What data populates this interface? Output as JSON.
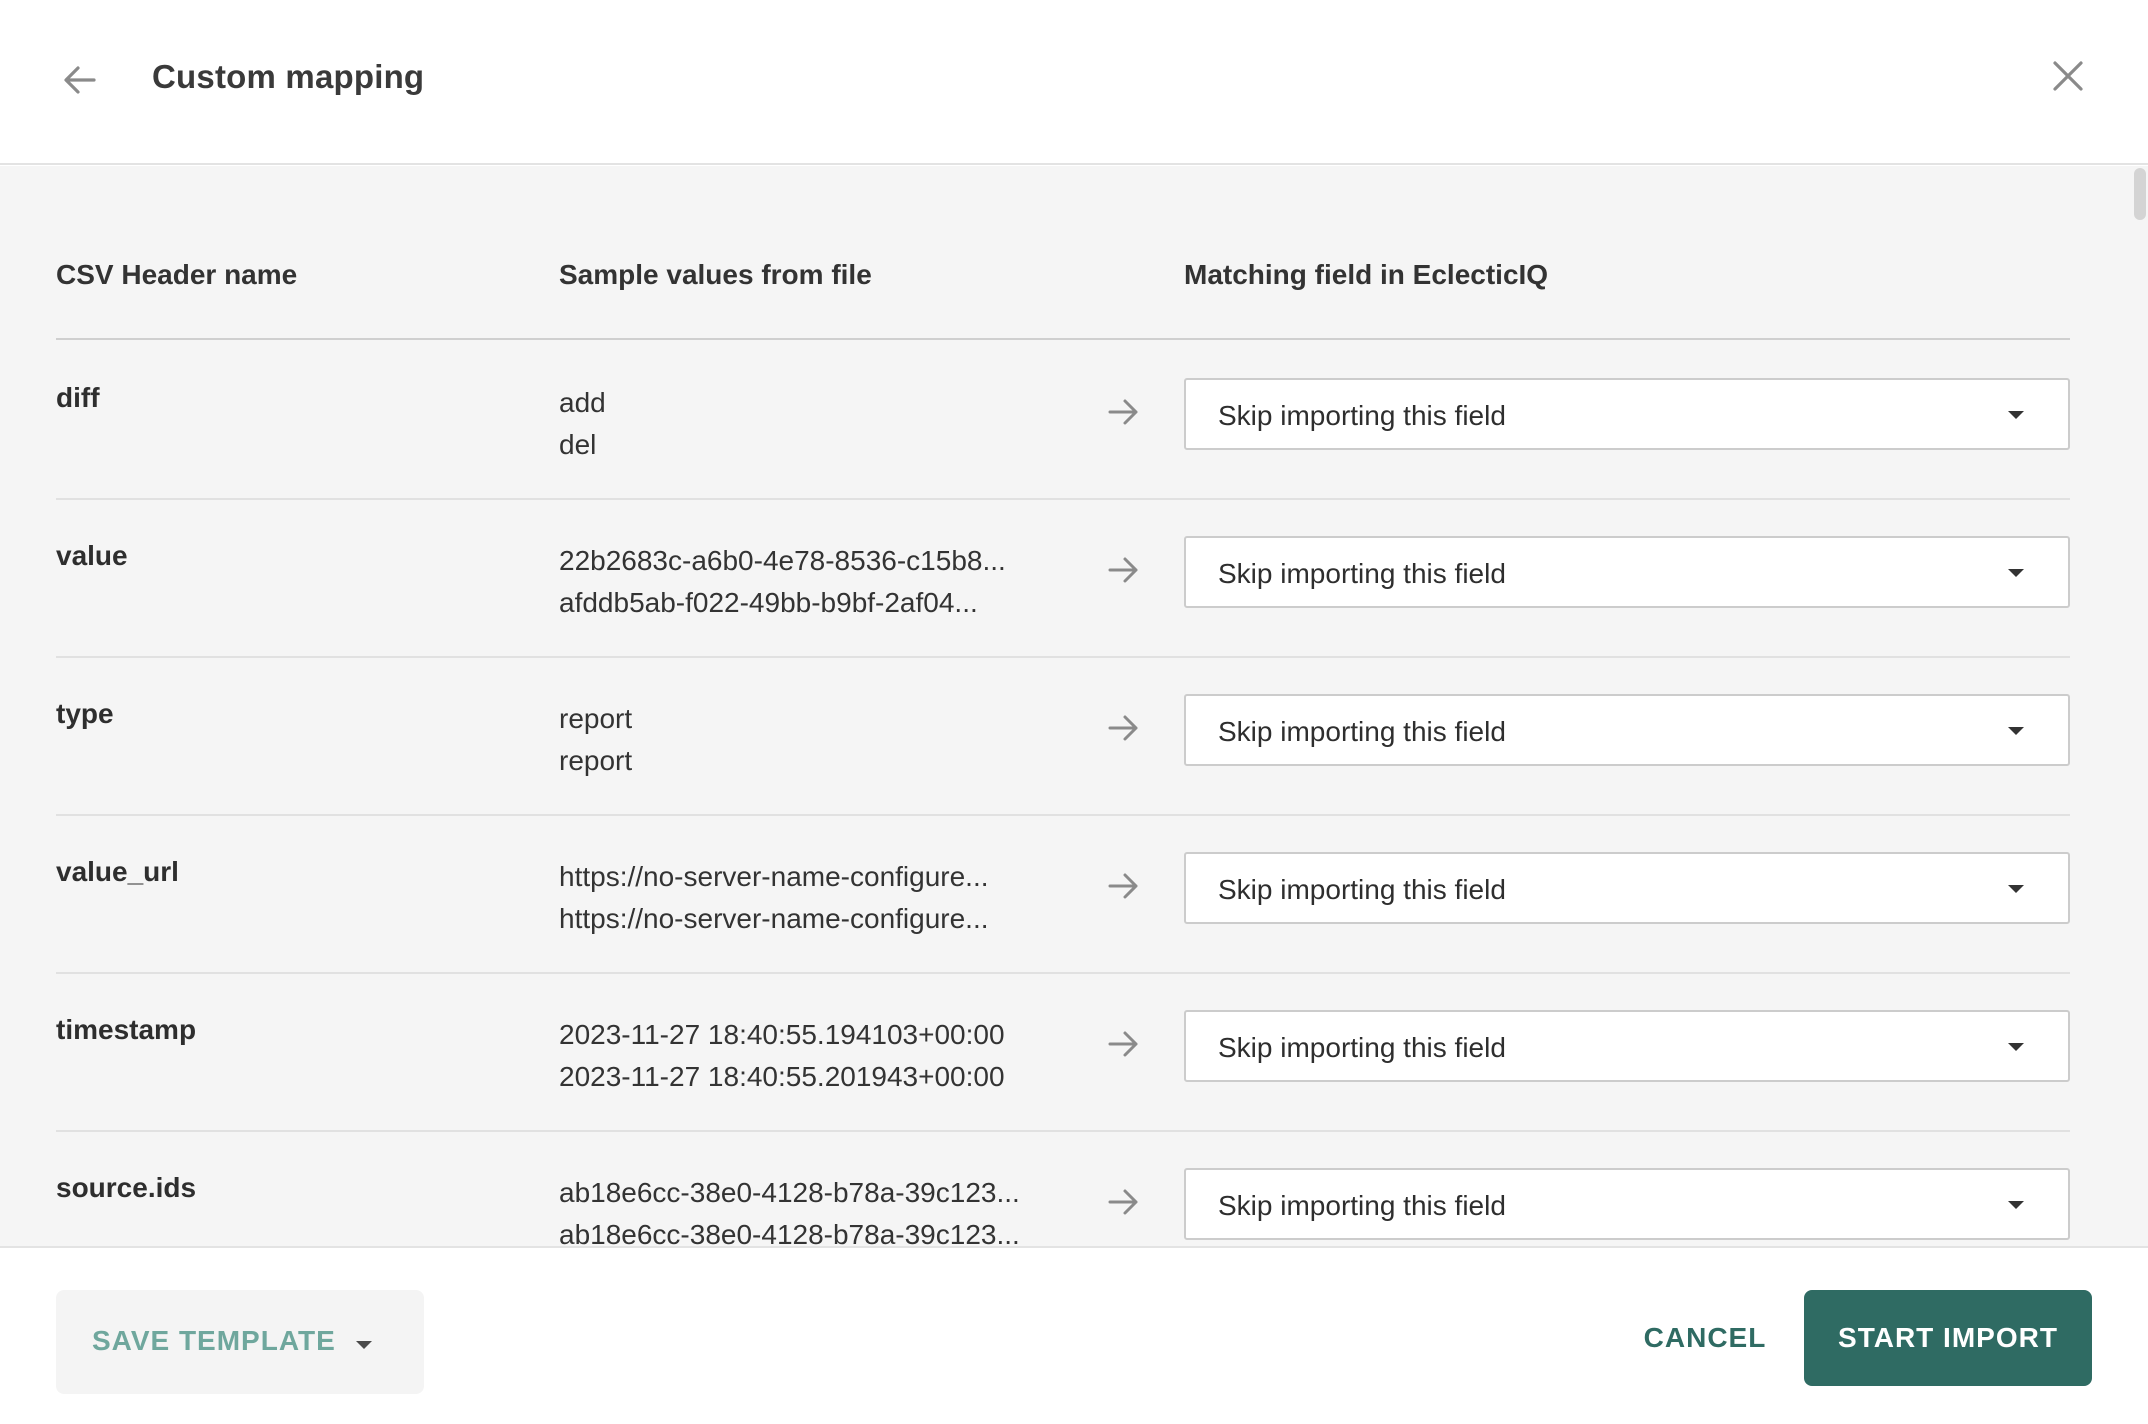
{
  "header": {
    "title": "Custom mapping",
    "back_icon": "arrow-left-icon",
    "close_icon": "close-icon"
  },
  "table": {
    "columns": [
      "CSV Header name",
      "Sample values from file",
      "Matching field in EclecticIQ"
    ],
    "rows": [
      {
        "header": "diff",
        "samples": [
          "add",
          "del"
        ],
        "mapping": "Skip importing this field"
      },
      {
        "header": "value",
        "samples": [
          "22b2683c-a6b0-4e78-8536-c15b8...",
          "afddb5ab-f022-49bb-b9bf-2af04..."
        ],
        "mapping": "Skip importing this field"
      },
      {
        "header": "type",
        "samples": [
          "report",
          "report"
        ],
        "mapping": "Skip importing this field"
      },
      {
        "header": "value_url",
        "samples": [
          "https://no-server-name-configure...",
          "https://no-server-name-configure..."
        ],
        "mapping": "Skip importing this field"
      },
      {
        "header": "timestamp",
        "samples": [
          "2023-11-27 18:40:55.194103+00:00",
          "2023-11-27 18:40:55.201943+00:00"
        ],
        "mapping": "Skip importing this field"
      },
      {
        "header": "source.ids",
        "samples": [
          "ab18e6cc-38e0-4128-b78a-39c123...",
          "ab18e6cc-38e0-4128-b78a-39c123..."
        ],
        "mapping": "Skip importing this field"
      }
    ]
  },
  "footer": {
    "save_template_label": "SAVE TEMPLATE",
    "cancel_label": "CANCEL",
    "start_import_label": "START IMPORT"
  },
  "colors": {
    "accent": "#2f6b63",
    "accent_light": "#6fa79d",
    "body_bg": "#f5f5f5"
  }
}
